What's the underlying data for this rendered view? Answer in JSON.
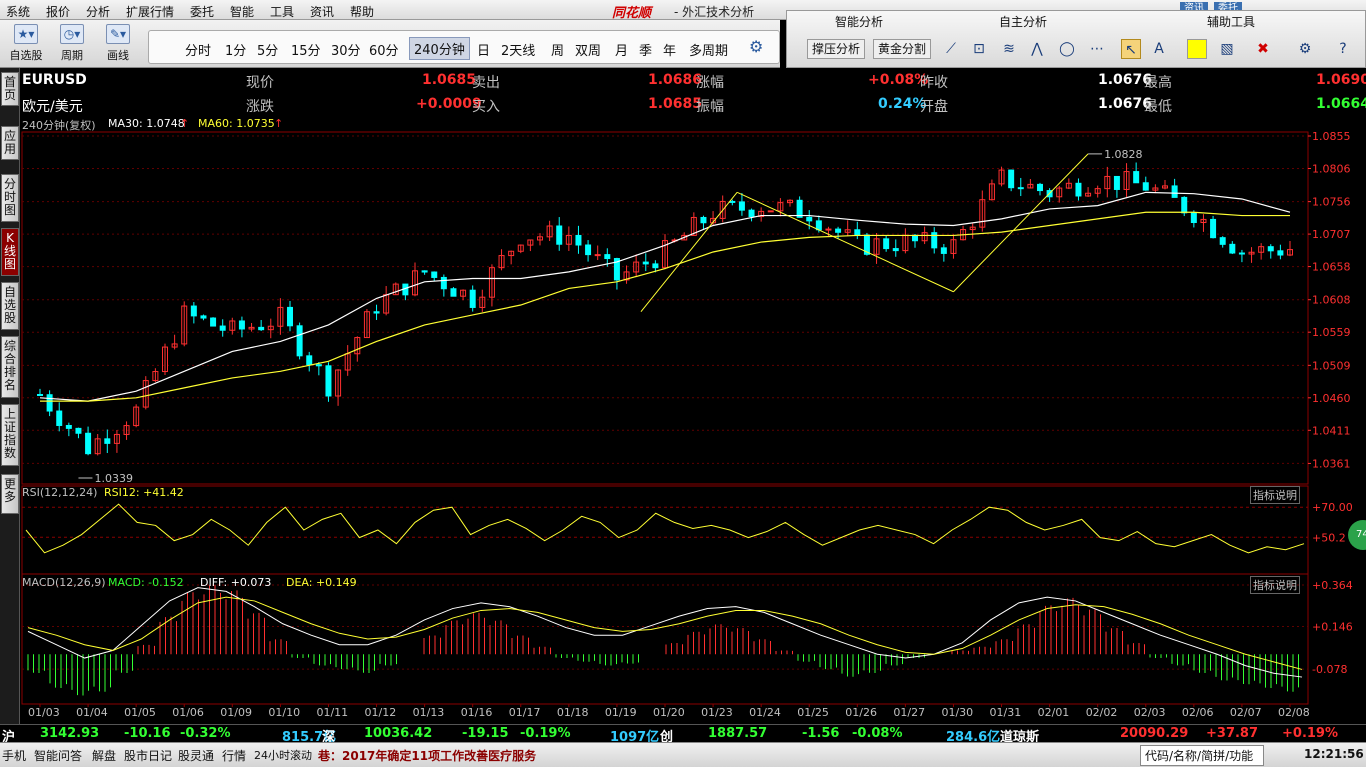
{
  "menubar": {
    "items": [
      "系统",
      "报价",
      "分析",
      "扩展行情",
      "委托",
      "智能",
      "工具",
      "资讯",
      "帮助"
    ],
    "logo": "同花顺",
    "title": "- 外汇技术分析",
    "right_tabs": [
      "资讯",
      "委托"
    ]
  },
  "toolbar": {
    "self_select": "自选股",
    "period": "周期",
    "draw": "画线",
    "periods": [
      "分时",
      "1分",
      "5分",
      "15分",
      "30分",
      "60分",
      "240分钟",
      "日",
      "2天线",
      "周",
      "双周",
      "月",
      "季",
      "年",
      "多周期"
    ],
    "active_period": "240分钟"
  },
  "right_panel": {
    "smart_title": "智能分析",
    "self_title": "自主分析",
    "aux_title": "辅助工具",
    "btn_support": "撑压分析",
    "btn_golden": "黄金分割",
    "icons": [
      "line-draw-icon",
      "rect-icon",
      "fib-icon",
      "wave-icon",
      "ellipse-icon"
    ],
    "aux_icons": [
      "pointer-icon",
      "text-icon",
      "color-icon",
      "brush-icon",
      "delete-icon",
      "gear-icon",
      "help-icon"
    ]
  },
  "sidebar": {
    "tabs": [
      "首页",
      "应用",
      "分时图",
      "K线图",
      "自选股",
      "综合排名",
      "上证指数",
      "更多"
    ],
    "active": "K线图"
  },
  "quote": {
    "symbol": "EURUSD",
    "name": "欧元/美元",
    "labels": [
      "现价",
      "卖出",
      "涨幅",
      "昨收",
      "最高",
      "涨跌",
      "买入",
      "振幅",
      "开盘",
      "最低"
    ],
    "now": "1.0685",
    "sell": "1.0686",
    "rise_pct": "+0.08%",
    "prev_close": "1.0676",
    "high": "1.0690",
    "change": "+0.0009",
    "buy": "1.0685",
    "amplitude": "0.24%",
    "open": "1.0676",
    "low": "1.0664"
  },
  "chart_header": {
    "period": "240分钟(复权)",
    "ma30": "MA30: 1.0748",
    "ma60": "MA60: 1.0735",
    "arrow_up": "↑"
  },
  "chart_data": {
    "type": "line",
    "title": "",
    "price_axis": [
      "1.0855",
      "1.0806",
      "1.0756",
      "1.0707",
      "1.0658",
      "1.0608",
      "1.0559",
      "1.0509",
      "1.0460",
      "1.0411",
      "1.0361"
    ],
    "price_range": [
      1.0336,
      1.0855
    ],
    "dates": [
      "01/03",
      "01/04",
      "01/05",
      "01/06",
      "01/09",
      "01/10",
      "01/11",
      "01/12",
      "01/13",
      "01/16",
      "01/17",
      "01/18",
      "01/19",
      "01/20",
      "01/23",
      "01/24",
      "01/25",
      "01/26",
      "01/27",
      "01/30",
      "01/31",
      "02/01",
      "02/02",
      "02/03",
      "02/06",
      "02/07",
      "02/08"
    ],
    "high_label": "1.0828",
    "low_label": "1.0339",
    "ma_series": [
      {
        "name": "MA30",
        "color": "#ffffff",
        "values": [
          1.046,
          1.0455,
          1.047,
          1.05,
          1.053,
          1.0545,
          1.057,
          1.061,
          1.0635,
          1.064,
          1.064,
          1.065,
          1.0665,
          1.069,
          1.072,
          1.0735,
          1.0735,
          1.0728,
          1.0722,
          1.072,
          1.073,
          1.0745,
          1.075,
          1.077,
          1.0768,
          1.076,
          1.074
        ]
      },
      {
        "name": "MA60",
        "color": "#ffff33",
        "values": [
          1.0455,
          1.0455,
          1.046,
          1.0475,
          1.049,
          1.05,
          1.0515,
          1.0545,
          1.057,
          1.0585,
          1.06,
          1.0625,
          1.0635,
          1.0655,
          1.068,
          1.0695,
          1.0702,
          1.0705,
          1.0705,
          1.0705,
          1.071,
          1.072,
          1.073,
          1.074,
          1.074,
          1.0735,
          1.0735
        ]
      }
    ],
    "close_series": [
      1.0465,
      1.0385,
      1.044,
      1.0585,
      1.056,
      1.058,
      1.048,
      1.06,
      1.065,
      1.061,
      1.0705,
      1.0705,
      1.064,
      1.068,
      1.074,
      1.075,
      1.074,
      1.069,
      1.0695,
      1.069,
      1.079,
      1.077,
      1.079,
      1.078,
      1.074,
      1.068,
      1.0685
    ],
    "trend_lines": [
      {
        "from": [
          0,
          1.0339
        ],
        "to": [
          0,
          1.0339
        ]
      },
      {
        "from": [
          12.5,
          1.059
        ],
        "to": [
          14.5,
          1.077
        ]
      },
      {
        "from": [
          14.5,
          1.077
        ],
        "to": [
          19,
          1.062
        ]
      },
      {
        "from": [
          19,
          1.062
        ],
        "to": [
          21.8,
          1.0828
        ]
      }
    ],
    "rsi": {
      "label": "RSI(12,12,24)",
      "value": "RSI12: +41.42",
      "axis": [
        "+70.00",
        "+50.2"
      ],
      "values": [
        55,
        40,
        45,
        52,
        62,
        72,
        60,
        58,
        48,
        52,
        62,
        55,
        45,
        60,
        70,
        55,
        62,
        66,
        50,
        55,
        46,
        60,
        68,
        70,
        52,
        58,
        62,
        56,
        48,
        55,
        64,
        60,
        50,
        55,
        66,
        60,
        56,
        58,
        55,
        50,
        54,
        60,
        52,
        45,
        50,
        55,
        58,
        55,
        52,
        46,
        55,
        62,
        70,
        68,
        60,
        55,
        58,
        62,
        50,
        48,
        54,
        46,
        44,
        48,
        52,
        45,
        40,
        44,
        42,
        46
      ]
    },
    "macd": {
      "label": "MACD(12,26,9)",
      "macd_value": "MACD: -0.152",
      "diff_value": "DIFF: +0.073",
      "dea_value": "DEA: +0.149",
      "axis": [
        "+0.364",
        "+0.146",
        "-0.078"
      ],
      "range": [
        -0.23,
        0.39
      ],
      "hist": [
        -0.1,
        -0.18,
        -0.22,
        -0.2,
        -0.1,
        0.05,
        0.2,
        0.33,
        0.37,
        0.34,
        0.22,
        0.08,
        -0.02,
        -0.06,
        -0.08,
        -0.1,
        -0.06,
        0.0,
        0.1,
        0.18,
        0.22,
        0.18,
        0.1,
        0.04,
        -0.02,
        -0.04,
        -0.06,
        -0.05,
        0.0,
        0.06,
        0.12,
        0.16,
        0.14,
        0.08,
        0.02,
        -0.04,
        -0.08,
        -0.12,
        -0.1,
        -0.06,
        -0.02,
        0.0,
        0.02,
        0.04,
        0.08,
        0.16,
        0.26,
        0.3,
        0.24,
        0.14,
        0.06,
        -0.02,
        -0.06,
        -0.1,
        -0.14,
        -0.16,
        -0.18,
        -0.2
      ],
      "diff": [
        0.12,
        0.05,
        -0.02,
        0.02,
        0.15,
        0.28,
        0.35,
        0.33,
        0.25,
        0.16,
        0.1,
        0.05,
        0.05,
        0.1,
        0.18,
        0.24,
        0.27,
        0.25,
        0.2,
        0.14,
        0.1,
        0.1,
        0.15,
        0.2,
        0.24,
        0.25,
        0.22,
        0.16,
        0.1,
        0.05,
        0.0,
        -0.02,
        0.0,
        0.06,
        0.18,
        0.27,
        0.3,
        0.28,
        0.22,
        0.16,
        0.1,
        0.05,
        0.0,
        -0.06,
        -0.1,
        -0.12
      ],
      "dea": [
        0.14,
        0.1,
        0.05,
        0.02,
        0.08,
        0.18,
        0.27,
        0.3,
        0.28,
        0.22,
        0.16,
        0.11,
        0.08,
        0.09,
        0.13,
        0.19,
        0.23,
        0.24,
        0.22,
        0.18,
        0.14,
        0.12,
        0.13,
        0.16,
        0.2,
        0.23,
        0.23,
        0.2,
        0.16,
        0.1,
        0.05,
        0.01,
        0.0,
        0.03,
        0.1,
        0.18,
        0.24,
        0.26,
        0.25,
        0.21,
        0.16,
        0.1,
        0.05,
        0.0,
        -0.04,
        -0.08
      ]
    },
    "indicator_btn": "指标说明"
  },
  "ticker": {
    "sh_label": "沪",
    "sh_value": "3142.93",
    "sh_change": "-10.16",
    "sh_pct": "-0.32%",
    "sh_amount": "815.7亿",
    "sz_label": "深",
    "sz_value": "10036.42",
    "sz_change": "-19.15",
    "sz_pct": "-0.19%",
    "sz_amount": "1097亿",
    "cy_label": "创",
    "cy_value": "1887.57",
    "cy_change": "-1.56",
    "cy_pct": "-0.08%",
    "cy_amount": "284.6亿",
    "dj_label": "道琼斯",
    "dj_value": "20090.29",
    "dj_change": "+37.87",
    "dj_pct": "+0.19%"
  },
  "status": {
    "items": [
      "手机",
      "智能问答",
      "解盘",
      "股市日记",
      "股灵通",
      "行情",
      "24小时滚动"
    ],
    "news": "巷：2017年确定11项工作改善医疗服务",
    "search": "代码/名称/简拼/功能",
    "time": "12:21:56"
  },
  "circle_badge": "74"
}
